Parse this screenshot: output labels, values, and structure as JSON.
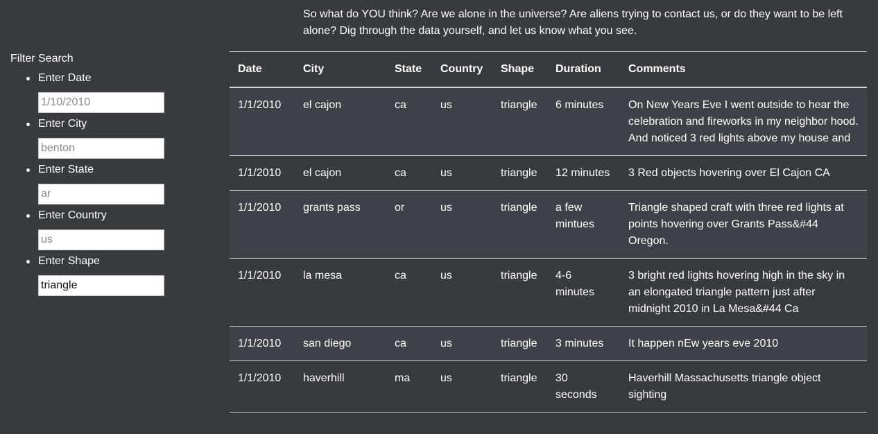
{
  "intro": "So what do YOU think? Are we alone in the universe? Are aliens trying to contact us, or do they want to be left alone? Dig through the data yourself, and let us know what you see.",
  "filters": {
    "title": "Filter Search",
    "items": [
      {
        "label": "Enter Date",
        "placeholder": "1/10/2010",
        "value": ""
      },
      {
        "label": "Enter City",
        "placeholder": "benton",
        "value": ""
      },
      {
        "label": "Enter State",
        "placeholder": "ar",
        "value": ""
      },
      {
        "label": "Enter Country",
        "placeholder": "us",
        "value": ""
      },
      {
        "label": "Enter Shape",
        "placeholder": "",
        "value": "triangle"
      }
    ]
  },
  "table": {
    "headers": [
      "Date",
      "City",
      "State",
      "Country",
      "Shape",
      "Duration",
      "Comments"
    ],
    "rows": [
      [
        "1/1/2010",
        "el cajon",
        "ca",
        "us",
        "triangle",
        "6 minutes",
        "On New Years Eve I went outside to hear the celebration and fireworks in my neighbor hood. And noticed 3 red lights above my house and"
      ],
      [
        "1/1/2010",
        "el cajon",
        "ca",
        "us",
        "triangle",
        "12 minutes",
        "3 Red objects hovering over El Cajon CA"
      ],
      [
        "1/1/2010",
        "grants pass",
        "or",
        "us",
        "triangle",
        "a few mintues",
        "Triangle shaped craft with three red lights at points hovering over Grants Pass&#44 Oregon."
      ],
      [
        "1/1/2010",
        "la mesa",
        "ca",
        "us",
        "triangle",
        "4-6 minutes",
        "3 bright red lights hovering high in the sky in an elongated triangle pattern just after midnight 2010 in La Mesa&#44 Ca"
      ],
      [
        "1/1/2010",
        "san diego",
        "ca",
        "us",
        "triangle",
        "3 minutes",
        "It happen nEw years eve 2010"
      ],
      [
        "1/1/2010",
        "haverhill",
        "ma",
        "us",
        "triangle",
        "30 seconds",
        "Haverhill Massachusetts triangle object sighting"
      ]
    ]
  }
}
